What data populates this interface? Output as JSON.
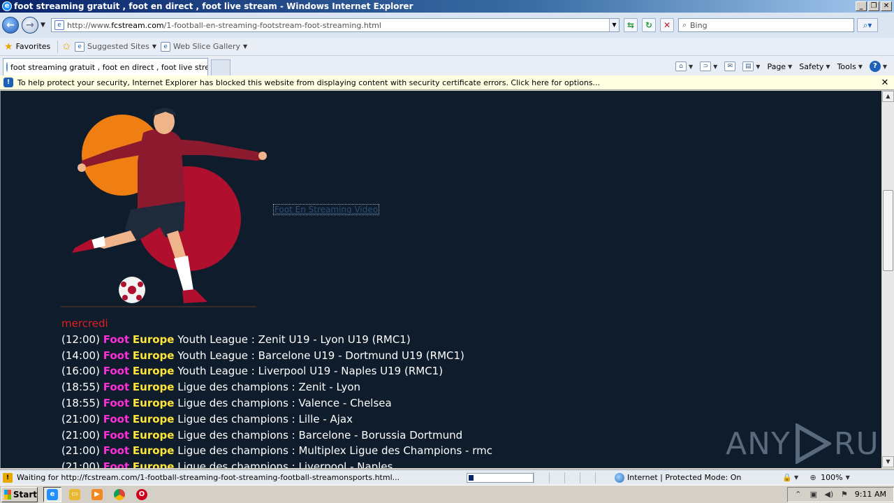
{
  "window": {
    "title": "foot streaming gratuit , foot en direct , foot live stream - Windows Internet Explorer",
    "controls": {
      "minimize": "_",
      "restore": "❐",
      "close": "✕"
    }
  },
  "address_bar": {
    "url_prefix": "http://www.",
    "url_domain": "fcstream.com",
    "url_path": "/1-football-en-streaming-footstream-foot-streaming.html",
    "search_placeholder": "Bing"
  },
  "favorites_bar": {
    "favorites_label": "Favorites",
    "suggested_sites": "Suggested Sites",
    "web_slice_gallery": "Web Slice Gallery"
  },
  "tabs": [
    {
      "label": "foot streaming gratuit , foot en direct , foot live stream"
    }
  ],
  "command_bar": {
    "page": "Page",
    "safety": "Safety",
    "tools": "Tools"
  },
  "info_bar": {
    "message": "To help protect your security, Internet Explorer has blocked this website from displaying content with security certificate errors. Click here for options..."
  },
  "content": {
    "stream_link": "Foot En Streaming Video",
    "day": "mercredi",
    "schedule": [
      {
        "time": "(12:00)",
        "foot": "Foot",
        "europe": "Europe",
        "desc": "Youth League : Zenit U19 - Lyon U19 (RMC1)"
      },
      {
        "time": "(14:00)",
        "foot": "Foot",
        "europe": "Europe",
        "desc": "Youth League : Barcelone U19 - Dortmund U19 (RMC1)"
      },
      {
        "time": "(16:00)",
        "foot": "Foot",
        "europe": "Europe",
        "desc": "Youth League : Liverpool U19 - Naples U19 (RMC1)"
      },
      {
        "time": "(18:55)",
        "foot": "Foot",
        "europe": "Europe",
        "desc": "Ligue des champions : Zenit - Lyon"
      },
      {
        "time": "(18:55)",
        "foot": "Foot",
        "europe": "Europe",
        "desc": "Ligue des champions : Valence - Chelsea"
      },
      {
        "time": "(21:00)",
        "foot": "Foot",
        "europe": "Europe",
        "desc": "Ligue des champions : Lille - Ajax"
      },
      {
        "time": "(21:00)",
        "foot": "Foot",
        "europe": "Europe",
        "desc": "Ligue des champions : Barcelone - Borussia Dortmund"
      },
      {
        "time": "(21:00)",
        "foot": "Foot",
        "europe": "Europe",
        "desc": "Ligue des champions : Multiplex Ligue des Champions - rmc"
      },
      {
        "time": "(21:00)",
        "foot": "Foot",
        "europe": "Europe",
        "desc": "Ligue des champions : Liverpool - Naples"
      }
    ],
    "watermark_left": "ANY",
    "watermark_right": "RUN"
  },
  "status_bar": {
    "text": "Waiting for http://fcstream.com/1-football-streaming-foot-streaming-football-streamonsports.html...",
    "progress": 0.08,
    "zone": "Internet | Protected Mode: On",
    "zoom": "100%"
  },
  "taskbar": {
    "start_label": "Start",
    "clock": "9:11 AM"
  },
  "colors": {
    "page_bg": "#0e1c2c",
    "foot_color": "#ff2fd8",
    "europe_color": "#ffe53a",
    "day_color": "#e02020"
  }
}
